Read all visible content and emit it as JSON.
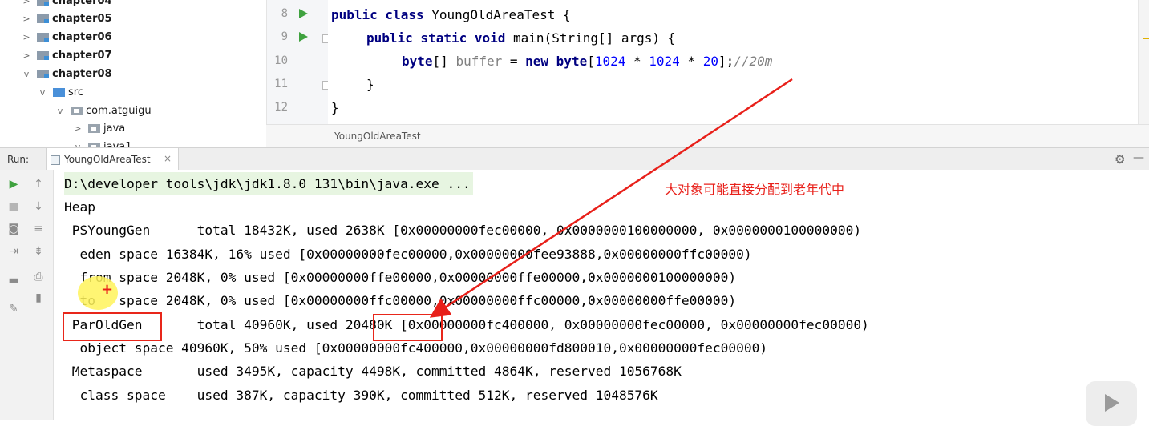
{
  "tree": {
    "items": [
      {
        "label": "chapter04",
        "chevron": ">"
      },
      {
        "label": "chapter05",
        "chevron": ">"
      },
      {
        "label": "chapter06",
        "chevron": ">"
      },
      {
        "label": "chapter07",
        "chevron": ">"
      },
      {
        "label": "chapter08",
        "chevron": "v"
      },
      {
        "label": "src",
        "chevron": "v"
      },
      {
        "label": "com.atguigu",
        "chevron": "v"
      },
      {
        "label": "java",
        "chevron": ">"
      },
      {
        "label": "java1",
        "chevron": "v"
      }
    ]
  },
  "editor": {
    "line_numbers": [
      "8",
      "9",
      "10",
      "11",
      "12"
    ],
    "lines": [
      {
        "kw1": "public class",
        "text": " YoungOldAreaTest {"
      },
      {
        "kw1": "public static void",
        "text": " main(String[] args) {"
      },
      {
        "kw1": "byte",
        "text1": "[] ",
        "var": "buffer",
        "text2": " = ",
        "kw2": "new byte",
        "text3": "[",
        "n1": "1024",
        "text4": " * ",
        "n2": "1024",
        "text5": " * ",
        "n3": "20",
        "text6": "];",
        "comment": "//20m"
      },
      {
        "text": "}"
      },
      {
        "text": "}"
      }
    ],
    "breadcrumb": "YoungOldAreaTest"
  },
  "run": {
    "title": "Run:",
    "tab_label": "YoungOldAreaTest",
    "tab_close": "×",
    "gear": "⚙",
    "minimize": "—"
  },
  "console": {
    "lines": [
      "D:\\developer_tools\\jdk\\jdk1.8.0_131\\bin\\java.exe ...",
      "Heap",
      " PSYoungGen      total 18432K, used 2638K [0x00000000fec00000, 0x0000000100000000, 0x0000000100000000)",
      "  eden space 16384K, 16% used [0x00000000fec00000,0x00000000fee93888,0x00000000ffc00000)",
      "  from space 2048K, 0% used [0x00000000ffe00000,0x00000000ffe00000,0x0000000100000000)",
      "  to   space 2048K, 0% used [0x00000000ffc00000,0x00000000ffc00000,0x00000000ffe00000)",
      " ParOldGen       total 40960K, used 20480K [0x00000000fc400000, 0x00000000fec00000, 0x00000000fec00000)",
      "  object space 40960K, 50% used [0x00000000fc400000,0x00000000fd800010,0x00000000fec00000)",
      " Metaspace       used 3495K, capacity 4498K, committed 4864K, reserved 1056768K",
      "  class space    used 387K, capacity 390K, committed 512K, reserved 1048576K"
    ]
  },
  "annotation": {
    "note": "大对象可能直接分配到老年代中",
    "cursor_mark": "+"
  },
  "colors": {
    "annotation_red": "#e8201a",
    "keyword": "#000080",
    "number": "#0000ff",
    "run_green": "#3fa23f"
  }
}
